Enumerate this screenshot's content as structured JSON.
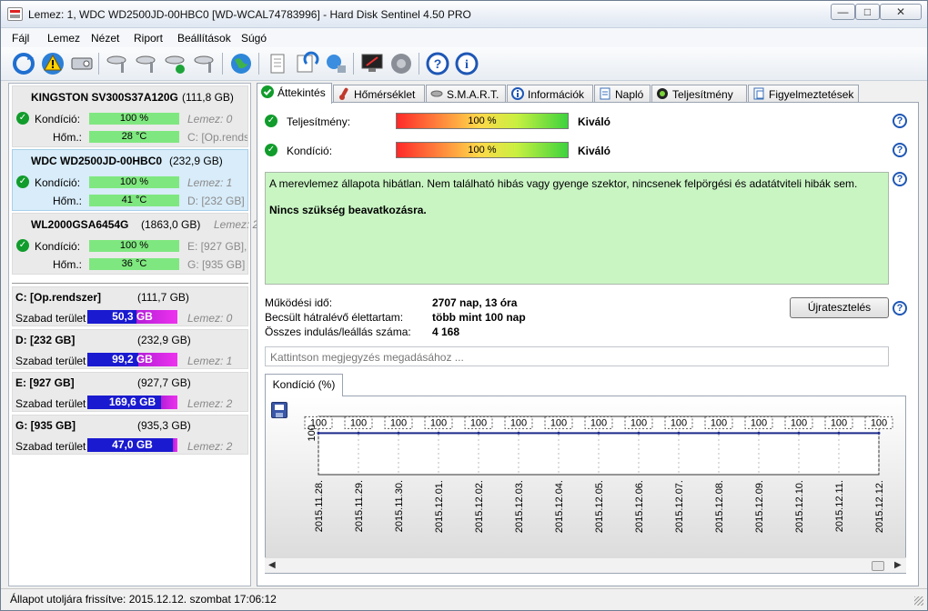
{
  "window": {
    "title": "Lemez: 1, WDC WD2500JD-00HBC0 [WD-WCAL74783996]  -  Hard Disk Sentinel 4.50 PRO",
    "min_glyph": "—",
    "max_glyph": "□",
    "close_glyph": "✕"
  },
  "menu": [
    "Fájl",
    "Lemez",
    "Nézet",
    "Riport",
    "Beállítások",
    "Súgó"
  ],
  "disks": [
    {
      "name": "KINGSTON SV300S37A120G",
      "size": "(111,8 GB)",
      "condition_label": "Kondíció:",
      "condition": "100 %",
      "temp_label": "Hőm.:",
      "temp": "28 °C",
      "side1": "Lemez: 0",
      "side2": "C: [Op.rendszer]"
    },
    {
      "name": "WDC WD2500JD-00HBC0",
      "size": "(232,9 GB)",
      "condition_label": "Kondíció:",
      "condition": "100 %",
      "temp_label": "Hőm.:",
      "temp": "41 °C",
      "side1": "Lemez: 1",
      "side2": "D: [232 GB]"
    },
    {
      "name": "WL2000GSA6454G",
      "size": "(1863,0 GB)",
      "lemez": "Lemez: 2",
      "condition_label": "Kondíció:",
      "condition": "100 %",
      "temp_label": "Hőm.:",
      "temp": "36 °C",
      "side1": "E: [927 GB],",
      "side2": "G: [935 GB]"
    }
  ],
  "volumes": [
    {
      "name": "C: [Op.rendszer]",
      "size": "(111,7 GB)",
      "label": "Szabad terület",
      "free": "50,3 GB",
      "free_pct": 0.45,
      "lemez": "Lemez: 0"
    },
    {
      "name": "D: [232 GB]",
      "size": "(232,9 GB)",
      "label": "Szabad terület",
      "free": "99,2 GB",
      "free_pct": 0.43,
      "lemez": "Lemez: 1"
    },
    {
      "name": "E: [927 GB]",
      "size": "(927,7 GB)",
      "label": "Szabad terület",
      "free": "169,6 GB",
      "free_pct": 0.18,
      "lemez": "Lemez: 2"
    },
    {
      "name": "G: [935 GB]",
      "size": "(935,3 GB)",
      "label": "Szabad terület",
      "free": "47,0 GB",
      "free_pct": 0.05,
      "lemez": "Lemez: 2"
    }
  ],
  "tabs": [
    "Áttekintés",
    "Hőmérséklet",
    "S.M.A.R.T.",
    "Információk",
    "Napló",
    "Teljesítmény",
    "Figyelmeztetések"
  ],
  "overview": {
    "performance_label": "Teljesítmény:",
    "performance_value": "100 %",
    "performance_rating": "Kiváló",
    "condition_label": "Kondíció:",
    "condition_value": "100 %",
    "condition_rating": "Kiváló",
    "status_text": "A merevlemez állapota hibátlan. Nem található hibás vagy gyenge szektor, nincsenek felpörgési és adatátviteli hibák sem.",
    "status_action": "Nincs szükség beavatkozásra.",
    "uptime_label": "Működési idő:",
    "uptime_value": "2707 nap, 13 óra",
    "lifetime_label": "Becsült hátralévő élettartam:",
    "lifetime_value": "több mint 100 nap",
    "startstop_label": "Összes indulás/leállás száma:",
    "startstop_value": "4 168",
    "retest_label": "Újratesztelés",
    "note_placeholder": "Kattintson megjegyzés megadásához ...",
    "chart_tab": "Kondíció  (%)"
  },
  "help_glyph": "?",
  "chart_data": {
    "type": "line",
    "x": [
      "2015.11.28.",
      "2015.11.29.",
      "2015.11.30.",
      "2015.12.01.",
      "2015.12.02.",
      "2015.12.03.",
      "2015.12.04.",
      "2015.12.05.",
      "2015.12.06.",
      "2015.12.07.",
      "2015.12.08.",
      "2015.12.09.",
      "2015.12.10.",
      "2015.12.11.",
      "2015.12.12."
    ],
    "values": [
      100,
      100,
      100,
      100,
      100,
      100,
      100,
      100,
      100,
      100,
      100,
      100,
      100,
      100,
      100
    ],
    "yticks": [
      "100"
    ],
    "ylim": [
      0,
      100
    ]
  },
  "statusbar": "Állapot utoljára frissítve: 2015.12.12. szombat 17:06:12"
}
